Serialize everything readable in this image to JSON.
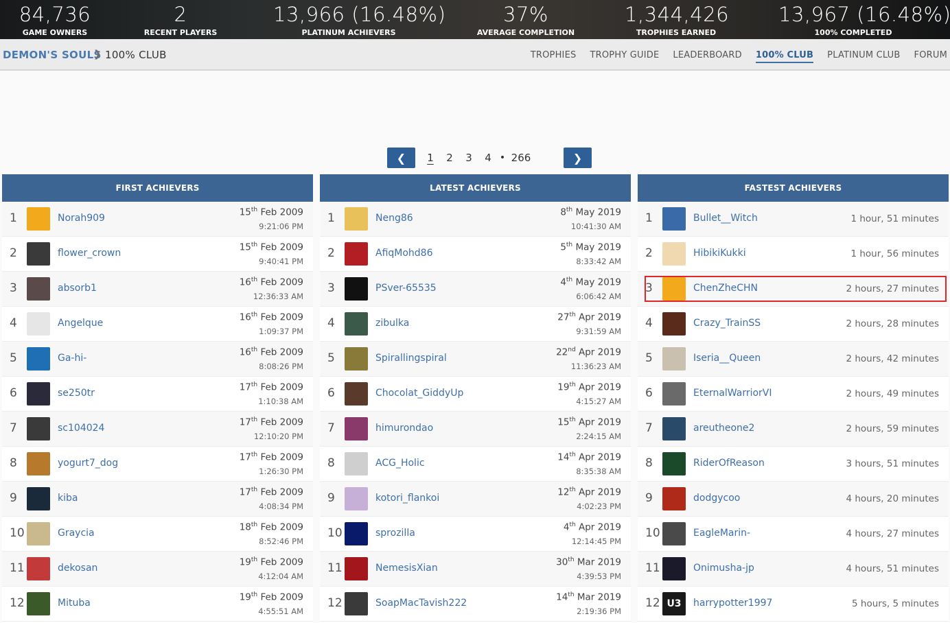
{
  "stats": [
    {
      "num": "84,736",
      "label": "GAME OWNERS"
    },
    {
      "num": "2",
      "label": "RECENT PLAYERS"
    },
    {
      "num": "13,966 (16.48%)",
      "label": "PLATINUM ACHIEVERS"
    },
    {
      "num": "37%",
      "label": "AVERAGE COMPLETION"
    },
    {
      "num": "1,344,426",
      "label": "TROPHIES EARNED"
    },
    {
      "num": "13,967 (16.48%)",
      "label": "100% COMPLETED"
    }
  ],
  "breadcrumb": {
    "game": "DEMON'S SOULS",
    "separator": "❯",
    "page": "100% CLUB"
  },
  "nav": [
    "TROPHIES",
    "TROPHY GUIDE",
    "LEADERBOARD",
    "100% CLUB",
    "PLATINUM CLUB",
    "FORUM"
  ],
  "nav_active": "100% CLUB",
  "pager": {
    "prev": "❮",
    "next": "❯",
    "pages": [
      "1",
      "2",
      "3",
      "4"
    ],
    "dot": "•",
    "last": "266"
  },
  "panels": {
    "first": {
      "title": "FIRST ACHIEVERS",
      "rows": [
        {
          "rank": "1",
          "user": "Norah909",
          "day": "15",
          "suf": "th",
          "date": "Feb 2009",
          "time": "9:21:06 PM",
          "avatar": "#f2a91c"
        },
        {
          "rank": "2",
          "user": "flower_crown",
          "day": "15",
          "suf": "th",
          "date": "Feb 2009",
          "time": "9:40:41 PM",
          "avatar": "#3a3a3a"
        },
        {
          "rank": "3",
          "user": "absorb1",
          "day": "16",
          "suf": "th",
          "date": "Feb 2009",
          "time": "12:36:33 AM",
          "avatar": "#5b4a4a"
        },
        {
          "rank": "4",
          "user": "Angelque",
          "day": "16",
          "suf": "th",
          "date": "Feb 2009",
          "time": "1:09:37 PM",
          "avatar": "#e6e6e6"
        },
        {
          "rank": "5",
          "user": "Ga-hi-",
          "day": "16",
          "suf": "th",
          "date": "Feb 2009",
          "time": "8:08:26 PM",
          "avatar": "#1f6fb5"
        },
        {
          "rank": "6",
          "user": "se250tr",
          "day": "17",
          "suf": "th",
          "date": "Feb 2009",
          "time": "1:10:38 AM",
          "avatar": "#2a2a3a"
        },
        {
          "rank": "7",
          "user": "sc104024",
          "day": "17",
          "suf": "th",
          "date": "Feb 2009",
          "time": "12:10:20 PM",
          "avatar": "#3a3a3a"
        },
        {
          "rank": "8",
          "user": "yogurt7_dog",
          "day": "17",
          "suf": "th",
          "date": "Feb 2009",
          "time": "1:26:30 PM",
          "avatar": "#b7792c"
        },
        {
          "rank": "9",
          "user": "kiba",
          "day": "17",
          "suf": "th",
          "date": "Feb 2009",
          "time": "4:08:34 PM",
          "avatar": "#1a2a3a"
        },
        {
          "rank": "10",
          "user": "Graycia",
          "day": "18",
          "suf": "th",
          "date": "Feb 2009",
          "time": "8:52:46 PM",
          "avatar": "#c9b98c"
        },
        {
          "rank": "11",
          "user": "dekosan",
          "day": "19",
          "suf": "th",
          "date": "Feb 2009",
          "time": "4:12:04 AM",
          "avatar": "#c23a3a"
        },
        {
          "rank": "12",
          "user": "Mituba",
          "day": "19",
          "suf": "th",
          "date": "Feb 2009",
          "time": "4:55:51 AM",
          "avatar": "#3a5a2a"
        }
      ]
    },
    "latest": {
      "title": "LATEST ACHIEVERS",
      "rows": [
        {
          "rank": "1",
          "user": "Neng86",
          "day": "8",
          "suf": "th",
          "date": "May 2019",
          "time": "10:41:30 AM",
          "avatar": "#e8c15a"
        },
        {
          "rank": "2",
          "user": "AfiqMohd86",
          "day": "5",
          "suf": "th",
          "date": "May 2019",
          "time": "8:33:42 AM",
          "avatar": "#b21e24"
        },
        {
          "rank": "3",
          "user": "PSver-65535",
          "day": "4",
          "suf": "th",
          "date": "May 2019",
          "time": "6:06:42 AM",
          "avatar": "#111111"
        },
        {
          "rank": "4",
          "user": "zibulka",
          "day": "27",
          "suf": "th",
          "date": "Apr 2019",
          "time": "9:31:59 AM",
          "avatar": "#3c5a4a"
        },
        {
          "rank": "5",
          "user": "Spirallingspiral",
          "day": "22",
          "suf": "nd",
          "date": "Apr 2019",
          "time": "11:36:23 AM",
          "avatar": "#8a7a3a"
        },
        {
          "rank": "6",
          "user": "Chocolat_GiddyUp",
          "day": "19",
          "suf": "th",
          "date": "Apr 2019",
          "time": "4:15:27 AM",
          "avatar": "#5a3a2a"
        },
        {
          "rank": "7",
          "user": "himurondao",
          "day": "15",
          "suf": "th",
          "date": "Apr 2019",
          "time": "2:24:15 AM",
          "avatar": "#8a3a6a"
        },
        {
          "rank": "8",
          "user": "ACG_Holic",
          "day": "14",
          "suf": "th",
          "date": "Apr 2019",
          "time": "8:35:38 AM",
          "avatar": "#cfcfcf"
        },
        {
          "rank": "9",
          "user": "kotori_flankoi",
          "day": "12",
          "suf": "th",
          "date": "Apr 2019",
          "time": "4:02:23 PM",
          "avatar": "#c7b0d8"
        },
        {
          "rank": "10",
          "user": "sprozilla",
          "day": "4",
          "suf": "th",
          "date": "Apr 2019",
          "time": "12:14:45 PM",
          "avatar": "#0a1a6a"
        },
        {
          "rank": "11",
          "user": "NemesisXian",
          "day": "30",
          "suf": "th",
          "date": "Mar 2019",
          "time": "4:39:53 PM",
          "avatar": "#a2161c"
        },
        {
          "rank": "12",
          "user": "SoapMacTavish222",
          "day": "14",
          "suf": "th",
          "date": "Mar 2019",
          "time": "2:19:36 PM",
          "avatar": "#3a3a3a"
        }
      ]
    },
    "fastest": {
      "title": "FASTEST ACHIEVERS",
      "rows": [
        {
          "rank": "1",
          "user": "Bullet__Witch",
          "dur": "1 hour, 51 minutes",
          "avatar": "#3a6aa8"
        },
        {
          "rank": "2",
          "user": "HibikiKukki",
          "dur": "1 hour, 56 minutes",
          "avatar": "#f0d8b0"
        },
        {
          "rank": "3",
          "user": "ChenZheCHN",
          "dur": "2 hours, 27 minutes",
          "avatar": "#f2a91c"
        },
        {
          "rank": "4",
          "user": "Crazy_TrainSS",
          "dur": "2 hours, 28 minutes",
          "avatar": "#5a2a1a"
        },
        {
          "rank": "5",
          "user": "Iseria__Queen",
          "dur": "2 hours, 42 minutes",
          "avatar": "#c9c0b0"
        },
        {
          "rank": "6",
          "user": "EternalWarriorVI",
          "dur": "2 hours, 49 minutes",
          "avatar": "#6a6a6a"
        },
        {
          "rank": "7",
          "user": "areutheone2",
          "dur": "2 hours, 59 minutes",
          "avatar": "#2a4a6a"
        },
        {
          "rank": "8",
          "user": "RiderOfReason",
          "dur": "3 hours, 51 minutes",
          "avatar": "#1a4a2a"
        },
        {
          "rank": "9",
          "user": "dodgycoo",
          "dur": "4 hours, 20 minutes",
          "avatar": "#b02a1a"
        },
        {
          "rank": "10",
          "user": "EagleMarin-",
          "dur": "4 hours, 27 minutes",
          "avatar": "#4a4a4a"
        },
        {
          "rank": "11",
          "user": "Onimusha-jp",
          "dur": "4 hours, 51 minutes",
          "avatar": "#1a1a2a"
        },
        {
          "rank": "12",
          "user": "harrypotter1997",
          "dur": "5 hours, 5 minutes",
          "avatar": "#1a1a1a",
          "badge": "U3"
        }
      ]
    }
  },
  "highlighted_row": "ChenZheCHN"
}
